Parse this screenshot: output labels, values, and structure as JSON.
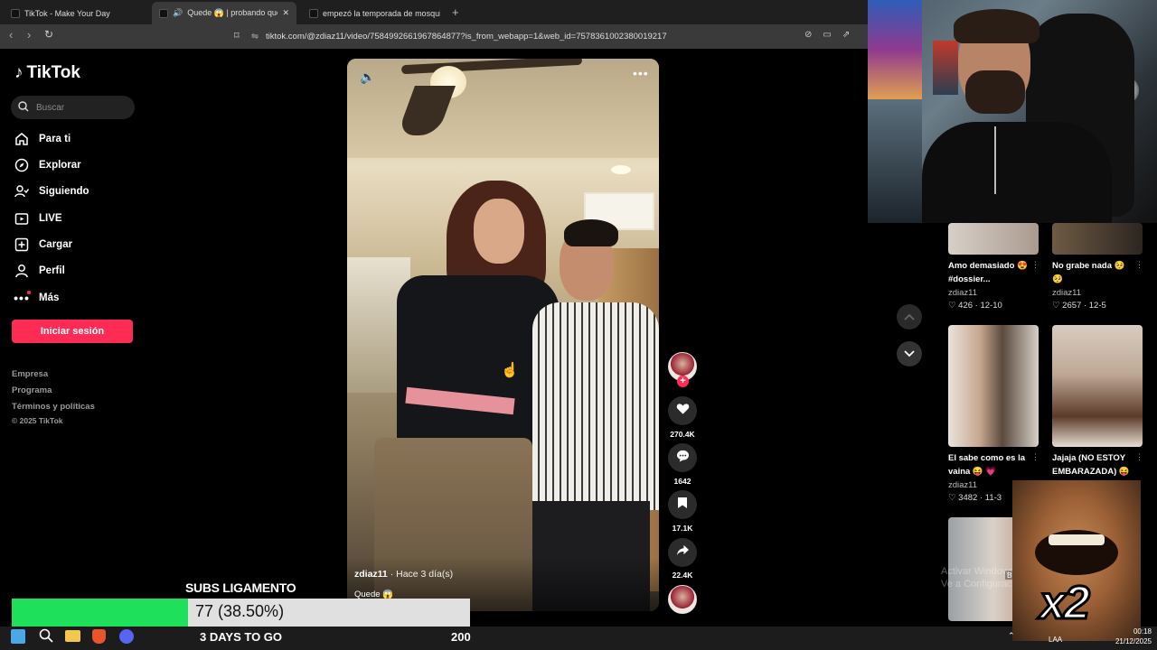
{
  "browser": {
    "tabs": [
      {
        "label": "TikTok - Make Your Day"
      },
      {
        "label": "Quede 😱 | probando que ta"
      },
      {
        "label": "empezó la temporada de mosquitos"
      }
    ],
    "new_tab_icon": "plus-icon",
    "url": "tiktok.com/@zdiaz11/video/7584992661967864877?is_from_webapp=1&web_id=7578361002380019217"
  },
  "sidebar": {
    "logo": "TikTok",
    "search_placeholder": "Buscar",
    "nav": [
      {
        "label": "Para ti",
        "icon": "home-icon"
      },
      {
        "label": "Explorar",
        "icon": "compass-icon"
      },
      {
        "label": "Siguiendo",
        "icon": "following-icon"
      },
      {
        "label": "LIVE",
        "icon": "live-icon"
      },
      {
        "label": "Cargar",
        "icon": "upload-icon"
      },
      {
        "label": "Perfil",
        "icon": "profile-icon"
      },
      {
        "label": "Más",
        "icon": "more-icon"
      }
    ],
    "login": "Iniciar sesión",
    "footer": [
      "Empresa",
      "Programa",
      "Términos y políticas",
      "© 2025 TikTok"
    ]
  },
  "video": {
    "author": "zdiaz11",
    "time": "· Hace 3 día(s)",
    "caption": "Quede 😱",
    "likes": "270.4K",
    "comments": "1642",
    "saves": "17.1K",
    "shares": "22.4K"
  },
  "related": [
    {
      "title": "Amo demasiado 😍 #dossier...",
      "author": "zdiaz11",
      "likes": "426",
      "date": "12-10"
    },
    {
      "title": "No grabe nada 🥺 🥺",
      "author": "zdiaz11",
      "likes": "2657",
      "date": "12-5"
    },
    {
      "title": "El sabe como es la vaina 😝 💗",
      "author": "zdiaz11",
      "likes": "3482",
      "date": "11-3"
    },
    {
      "title": "Jajaja (NO ESTOY EMBARAZADA) 😝",
      "author": "",
      "likes": "",
      "date": ""
    }
  ],
  "overlay": {
    "subs_title": "SUBS LIGAMENTO",
    "progress": 0.385,
    "progress_label": "77 (38.50%)",
    "days": "3 DAYS TO GO",
    "goal": "200",
    "meme_text": "x2",
    "watermark": "Activar Windows\nVe a Configuración"
  },
  "taskbar": {
    "lang": "LAA",
    "time": "00:18",
    "date": "21/12/2025"
  },
  "colors": {
    "accent": "#fe2c55",
    "progress_fill": "#1ee05a"
  }
}
